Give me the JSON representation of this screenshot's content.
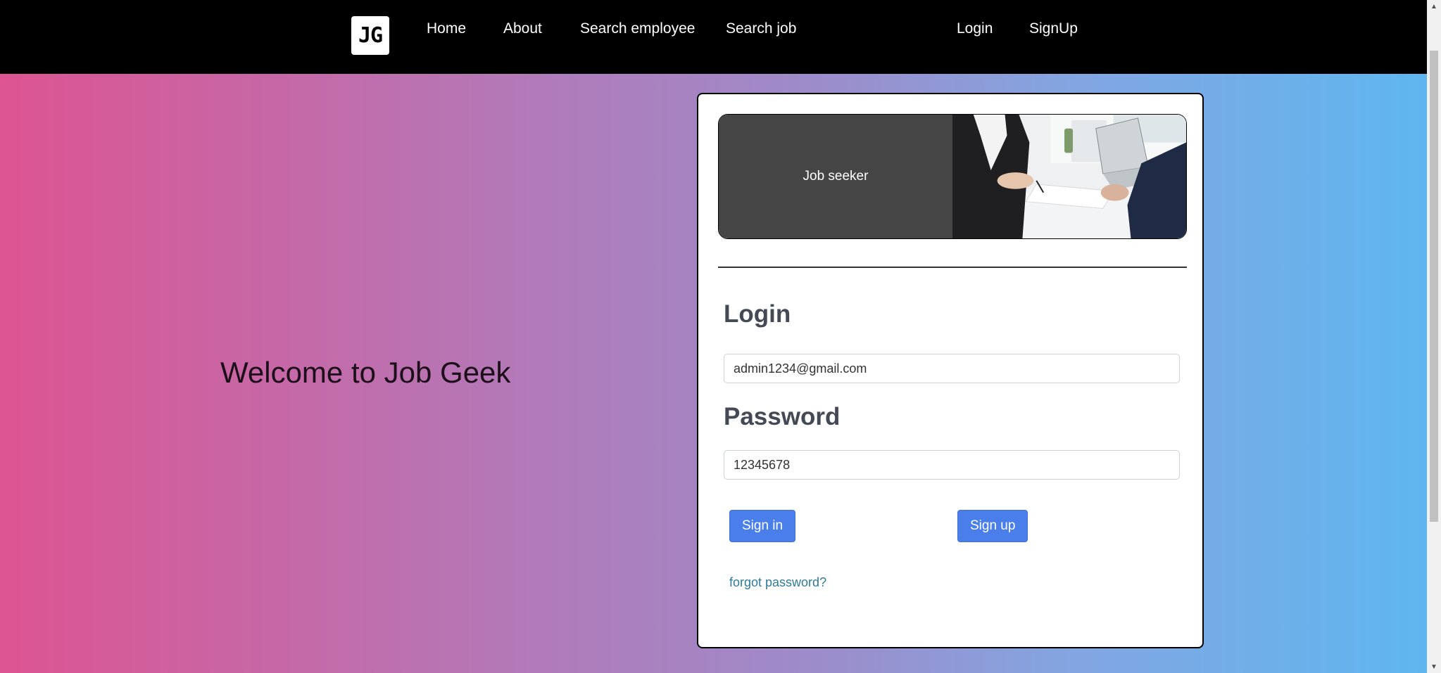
{
  "nav": {
    "logo_text": "JG",
    "links": [
      "Home",
      "About",
      "Search employee",
      "Search job"
    ],
    "auth_links": [
      "Login",
      "SignUp"
    ]
  },
  "hero": {
    "welcome_text": "Welcome to Job Geek"
  },
  "card": {
    "banner_label": "Job seeker",
    "login_title": "Login",
    "email_value": "admin1234@gmail.com",
    "password_title": "Password",
    "password_value": "12345678",
    "signin_label": "Sign in",
    "signup_label": "Sign up",
    "forgot_label": "forgot password?"
  },
  "colors": {
    "gradient_start": "#dd5492",
    "gradient_end": "#5db7f0",
    "button": "#4a7eeb",
    "link": "#2f7b9a",
    "banner_dark": "#454545"
  },
  "icons": {
    "scroll_up": "scroll-up-arrow-icon",
    "scroll_down": "scroll-down-arrow-icon"
  }
}
